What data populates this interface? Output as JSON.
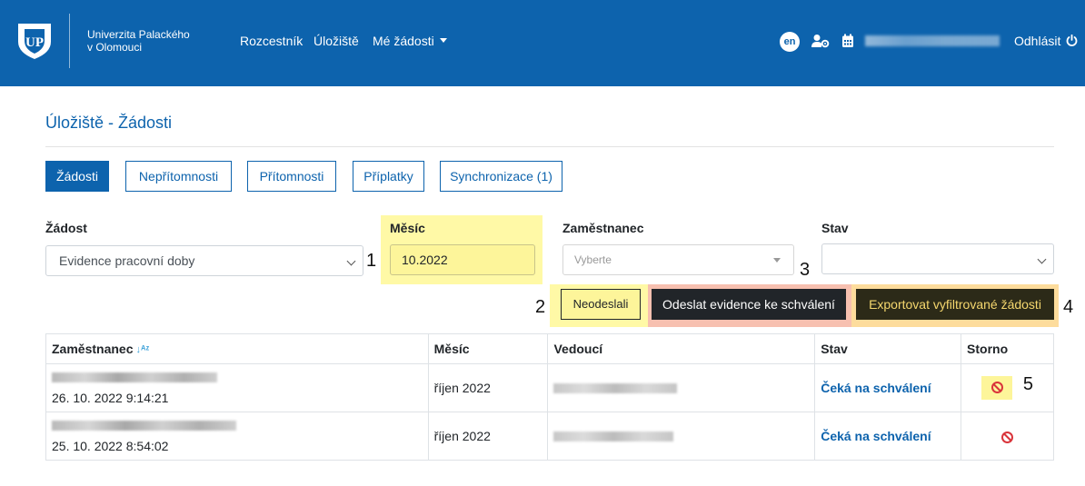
{
  "header": {
    "university_line1": "Univerzita Palackého",
    "university_line2": "v Olomouci",
    "nav": [
      "Rozcestník",
      "Úložiště",
      "Mé žádosti"
    ],
    "lang": "en",
    "logout": "Odhlásit",
    "brand_color": "#0d63ad"
  },
  "page": {
    "title": "Úložiště - Žádosti"
  },
  "tabs": [
    {
      "label": "Žádosti",
      "active": true
    },
    {
      "label": "Nepřítomnosti",
      "active": false
    },
    {
      "label": "Přítomnosti",
      "active": false
    },
    {
      "label": "Příplatky",
      "active": false
    },
    {
      "label": "Synchronizace (1)",
      "active": false
    }
  ],
  "filters": {
    "request_label": "Žádost",
    "request_value": "Evidence pracovní doby",
    "month_label": "Měsíc",
    "month_value": "10.2022",
    "employee_label": "Zaměstnanec",
    "employee_placeholder": "Vyberte",
    "status_label": "Stav",
    "status_value": ""
  },
  "markers": [
    "1",
    "2",
    "3",
    "4",
    "5"
  ],
  "actions": {
    "not_sent": "Neodeslali",
    "send": "Odeslat evidence ke schválení",
    "export": "Exportovat vyfiltrované žádosti"
  },
  "table": {
    "headers": [
      "Zaměstnanec",
      "Měsíc",
      "Vedoucí",
      "Stav",
      "Storno"
    ],
    "rows": [
      {
        "timestamp": "26. 10. 2022 9:14:21",
        "month": "říjen 2022",
        "status": "Čeká na schválení"
      },
      {
        "timestamp": "25. 10. 2022 8:54:02",
        "month": "říjen 2022",
        "status": "Čeká na schválení"
      }
    ]
  },
  "icons": {
    "sort": "sort-alpha-icon",
    "storno": "cancel-circle-icon",
    "lang": "language-badge-icon",
    "user_settings": "user-cog-icon",
    "calendar": "calendar-icon",
    "logout": "power-icon"
  }
}
